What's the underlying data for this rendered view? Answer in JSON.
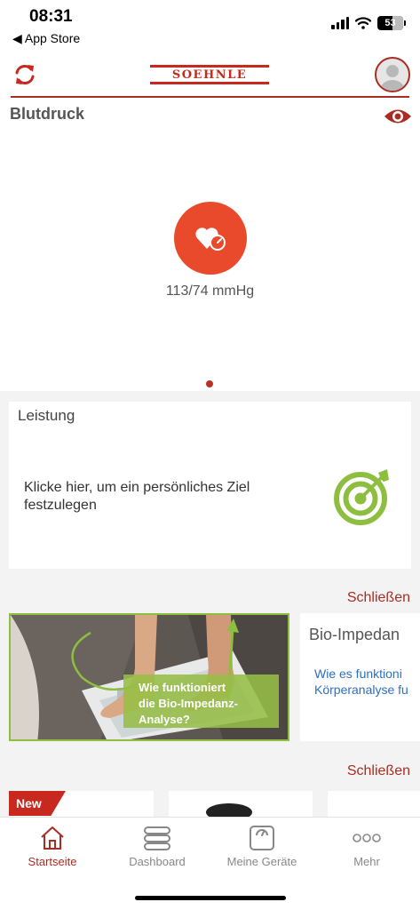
{
  "status_bar": {
    "time": "08:31",
    "back_label": "◀ App Store",
    "battery": "53"
  },
  "header": {
    "logo_text": "SOEHNLE"
  },
  "blood_pressure": {
    "title": "Blutdruck",
    "value": "113/74 mmHg"
  },
  "performance": {
    "title": "Leistung",
    "text": "Klicke hier, um ein persönliches Ziel festzulegen"
  },
  "bio_section": {
    "close_label": "Schließen",
    "image_caption_line1": "Wie funktioniert",
    "image_caption_line2": "die Bio-Impedanz-",
    "image_caption_line3": "Analyse?",
    "card_title": "Bio-Impedan",
    "card_link_line1": "Wie es funktioni",
    "card_link_line2": "Körperanalyse fu"
  },
  "products_section": {
    "close_label": "Schließen",
    "new_badge": "New"
  },
  "tab_bar": {
    "tabs": [
      {
        "label": "Startseite",
        "icon": "home-icon",
        "active": true
      },
      {
        "label": "Dashboard",
        "icon": "dashboard-icon",
        "active": false
      },
      {
        "label": "Meine Geräte",
        "icon": "scale-icon",
        "active": false
      },
      {
        "label": "Mehr",
        "icon": "more-icon",
        "active": false
      }
    ]
  },
  "colors": {
    "brand_red": "#c7291f",
    "accent_dark_red": "#a82d24",
    "heart_orange": "#e94a2c",
    "target_green": "#8dbe3f",
    "link_blue": "#2e6fc2"
  }
}
